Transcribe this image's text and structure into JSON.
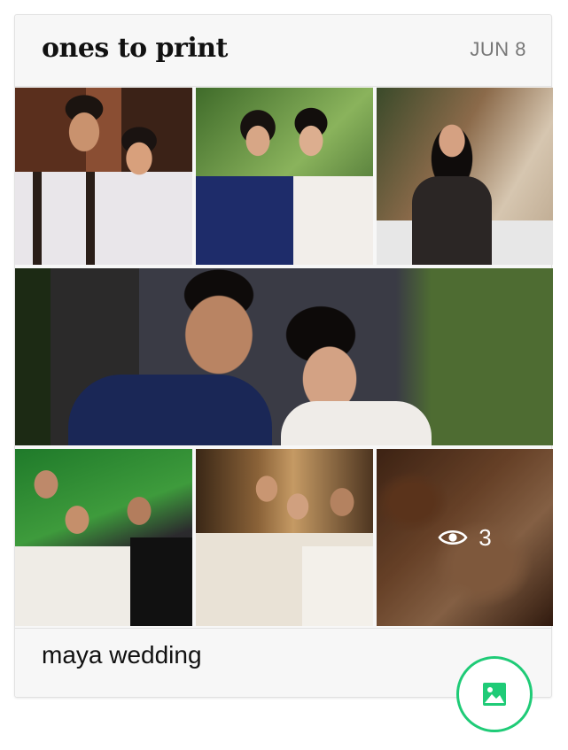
{
  "album": {
    "title": "ones to print",
    "date": "JUN 8",
    "name": "maya wedding"
  },
  "photos": [
    {
      "id": "photo-1",
      "alt": "couple portrait outdoors"
    },
    {
      "id": "photo-2",
      "alt": "two women smiling"
    },
    {
      "id": "photo-3",
      "alt": "guest at dinner table"
    },
    {
      "id": "photo-4",
      "alt": "newlyweds laughing"
    },
    {
      "id": "photo-5",
      "alt": "group of friends cheering"
    },
    {
      "id": "photo-6",
      "alt": "couple with microphone"
    },
    {
      "id": "photo-7",
      "alt": "blurred remaining photos"
    }
  ],
  "more_overlay": {
    "icon": "eye-icon",
    "count": "3"
  },
  "fab": {
    "icon": "image-icon",
    "color": "#1fcb77"
  }
}
